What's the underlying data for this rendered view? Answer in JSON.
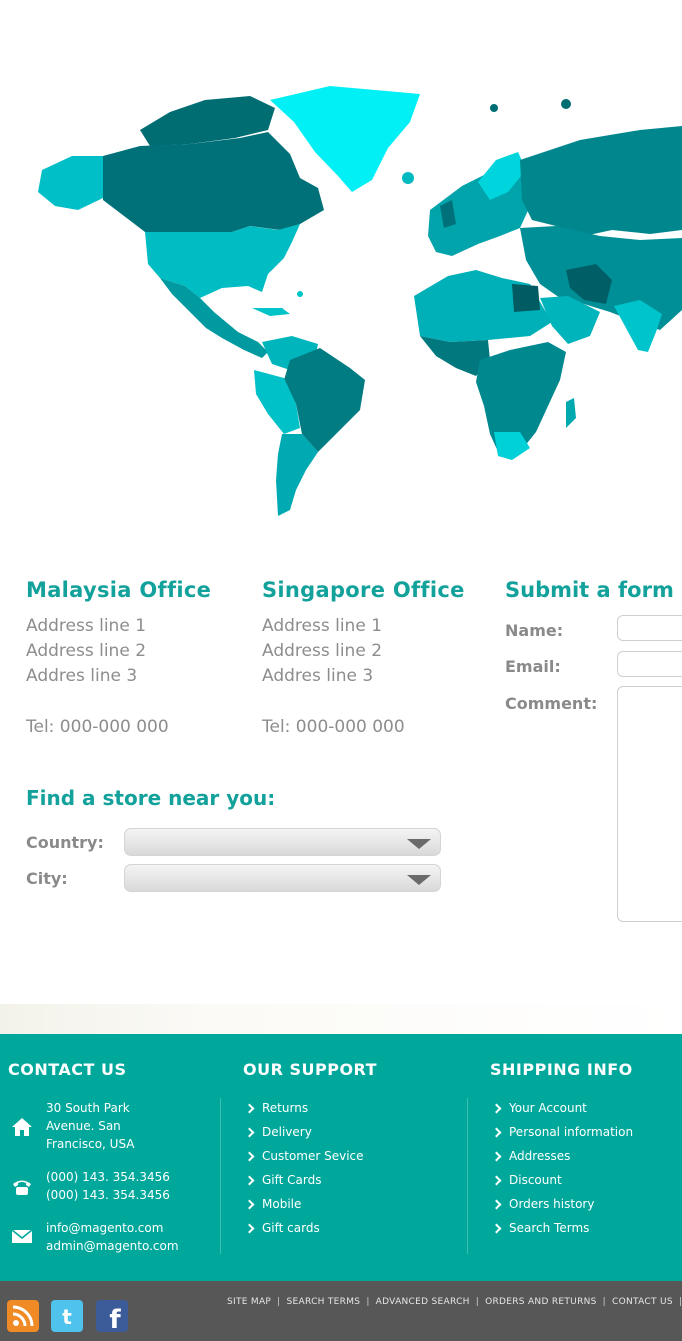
{
  "offices": [
    {
      "title": "Malaysia Office",
      "line1": "Address line 1",
      "line2": "Address line 2",
      "line3": "Addres line 3",
      "tel": "Tel: 000-000 000"
    },
    {
      "title": "Singapore Office",
      "line1": "Address line 1",
      "line2": "Address line 2",
      "line3": "Addres line 3",
      "tel": "Tel: 000-000 000"
    }
  ],
  "form": {
    "title": "Submit a form",
    "name_label": "Name:",
    "email_label": "Email:",
    "comment_label": "Comment:"
  },
  "finder": {
    "title": "Find a store near you:",
    "country_label": "Country:",
    "city_label": "City:"
  },
  "colors": {
    "accent": "#13a19b",
    "footer": "#00a89c",
    "bottom_bar": "#575757",
    "map_dark": "#006d72",
    "map_mid": "#00a6a6",
    "map_light": "#00e8f0"
  },
  "footer": {
    "contact": {
      "title": "CONTACT US",
      "address": [
        "30 South Park",
        "Avenue. San",
        "Francisco, USA"
      ],
      "phones": [
        "(000) 143. 354.3456",
        "(000) 143. 354.3456"
      ],
      "emails": [
        "info@magento.com",
        "admin@magento.com"
      ]
    },
    "support": {
      "title": "OUR SUPPORT",
      "links": [
        "Returns",
        "Delivery",
        "Customer Sevice",
        "Gift Cards",
        "Mobile",
        "Gift cards"
      ]
    },
    "shipping": {
      "title": "SHIPPING INFO",
      "links": [
        "Your Account",
        "Personal information",
        "Addresses",
        "Discount",
        "Orders history",
        "Search Terms"
      ]
    }
  },
  "bottom": {
    "social": [
      "rss-icon",
      "twitter-icon",
      "facebook-icon"
    ],
    "links": [
      "SITE MAP",
      "SEARCH TERMS",
      "ADVANCED SEARCH",
      "ORDERS AND RETURNS",
      "CONTACT US"
    ]
  }
}
